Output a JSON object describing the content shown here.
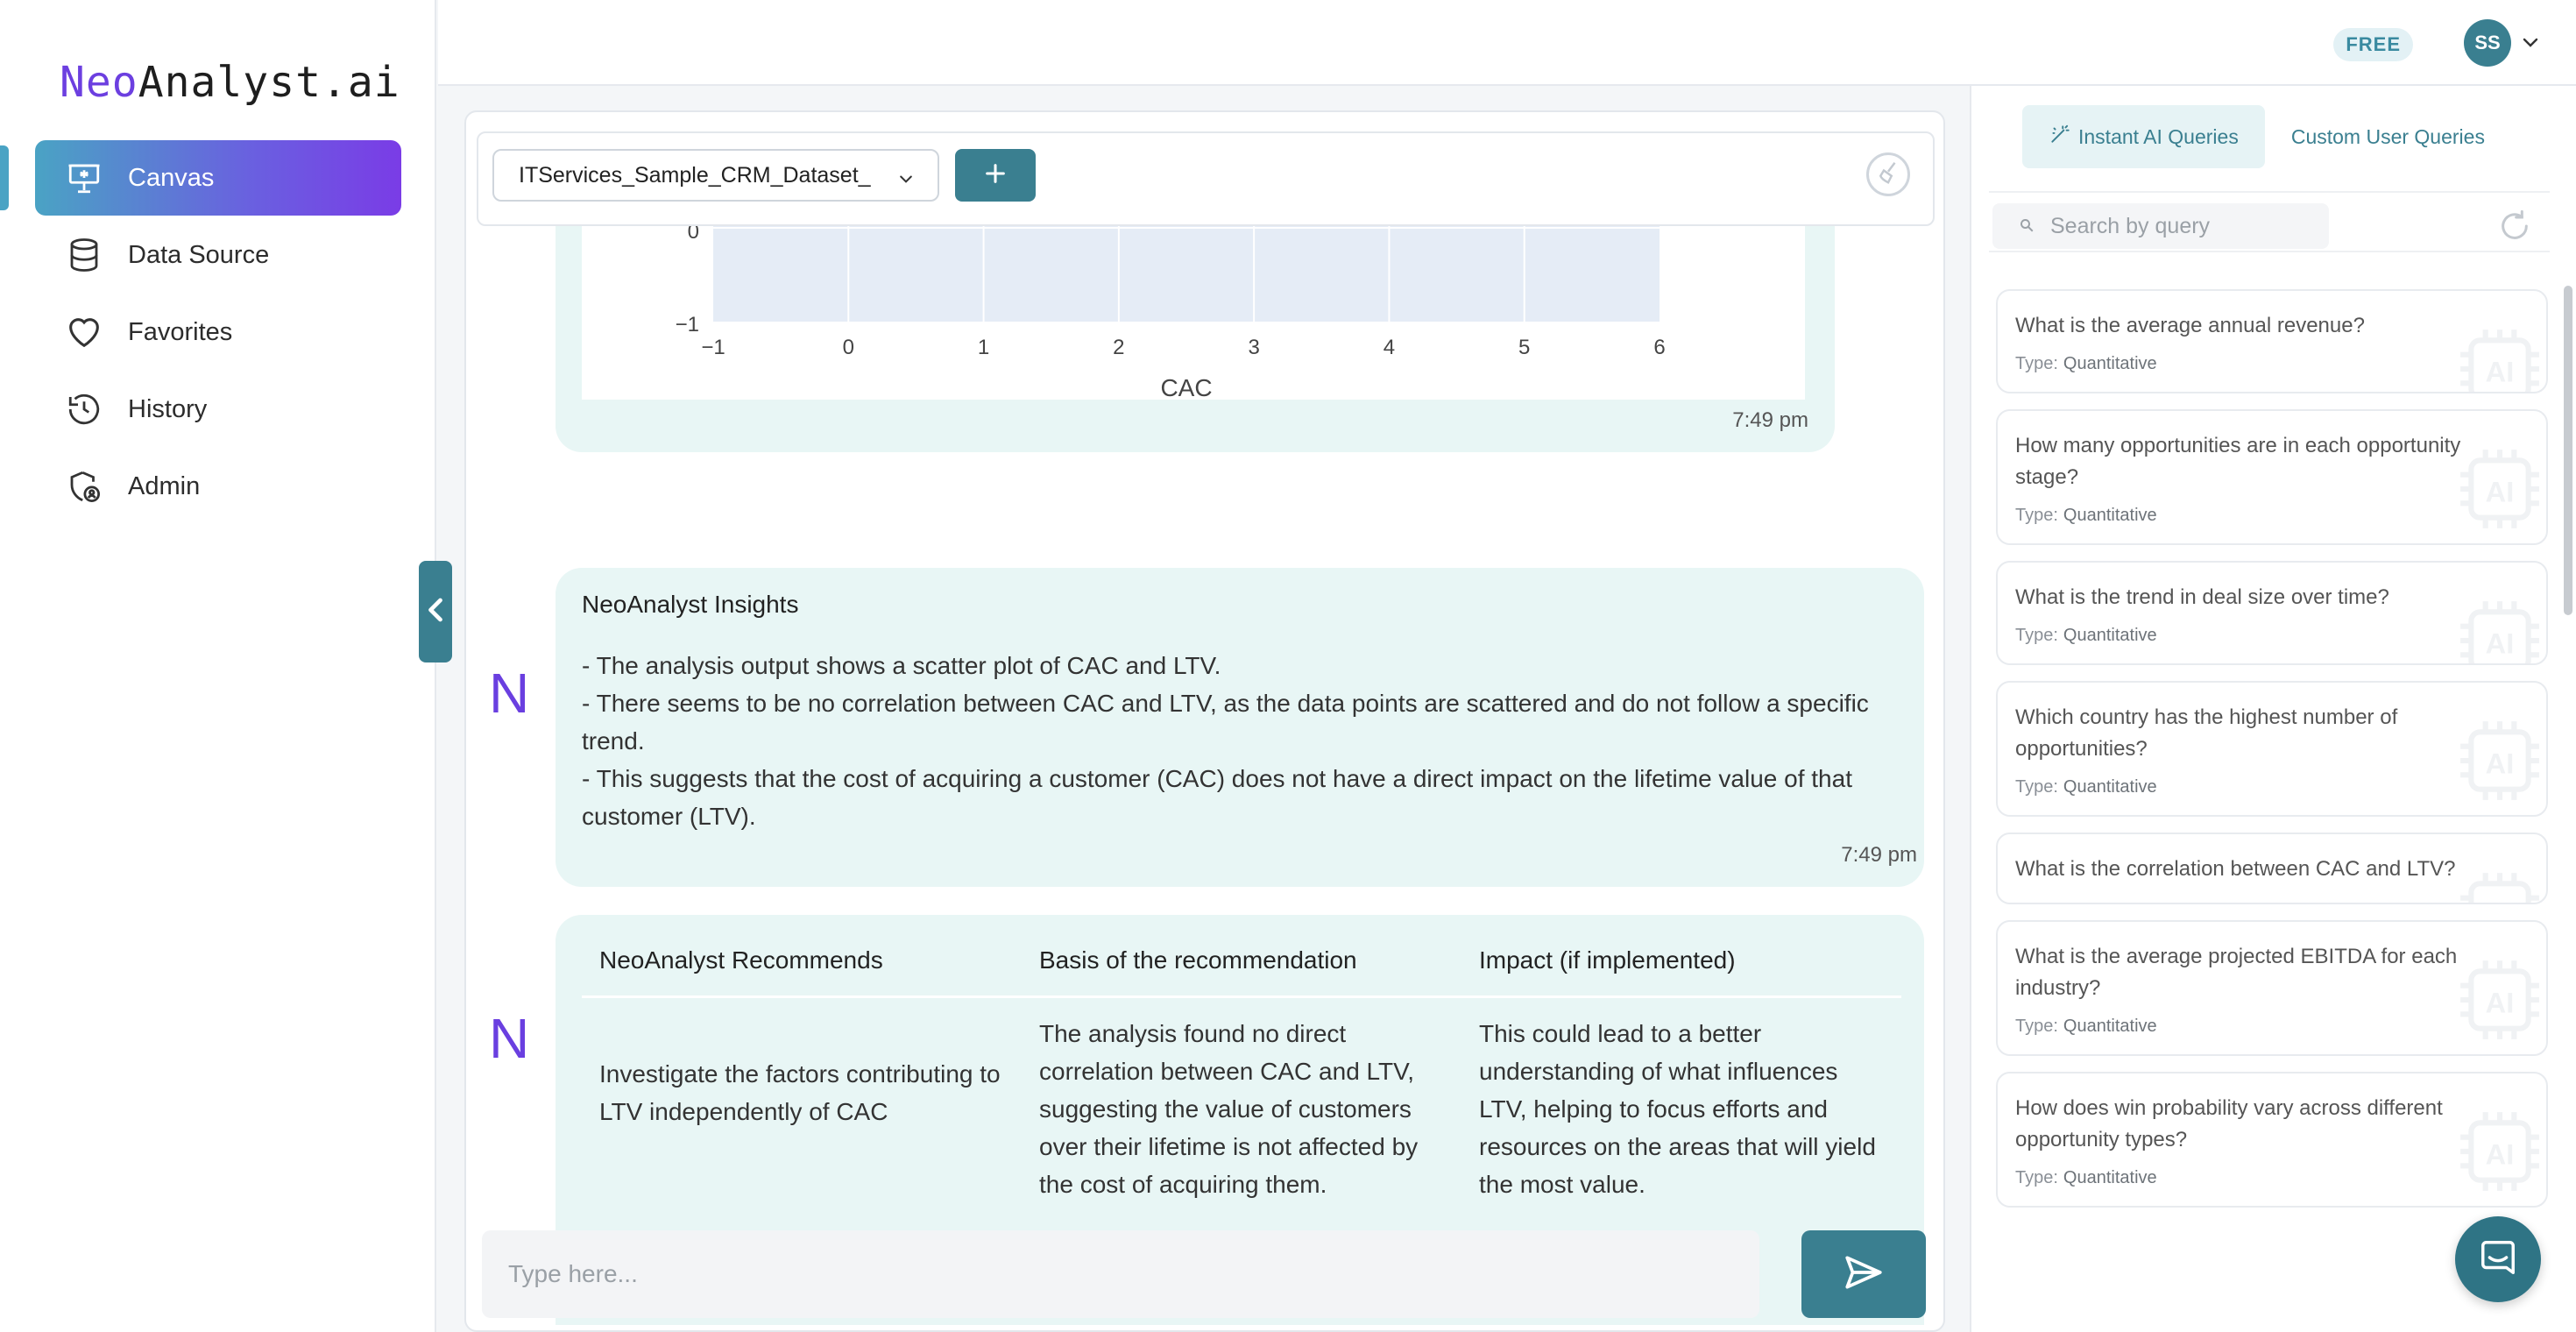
{
  "app": {
    "logo_part1": "Neo",
    "logo_part2": "Analyst.ai"
  },
  "sidebar": {
    "items": [
      {
        "label": "Canvas",
        "icon": "canvas-icon",
        "active": true
      },
      {
        "label": "Data Source",
        "icon": "database-icon",
        "active": false
      },
      {
        "label": "Favorites",
        "icon": "heart-icon",
        "active": false
      },
      {
        "label": "History",
        "icon": "history-icon",
        "active": false
      },
      {
        "label": "Admin",
        "icon": "admin-icon",
        "active": false
      }
    ]
  },
  "topbar": {
    "plan": "FREE",
    "avatar_initials": "SS"
  },
  "toolbar": {
    "dataset": "ITServices_Sample_CRM_Dataset_"
  },
  "chart": {
    "y_tick_labels": [
      "0",
      "−1"
    ],
    "x_tick_labels": [
      "−1",
      "0",
      "1",
      "2",
      "3",
      "4",
      "5",
      "6"
    ],
    "xlabel": "CAC"
  },
  "messages": {
    "chart_time": "7:49 pm",
    "avatar_letter": "N",
    "insights": {
      "title": "NeoAnalyst Insights",
      "lines": [
        "- The analysis output shows a scatter plot of CAC and LTV.",
        "- There seems to be no correlation between CAC and LTV, as the data points are scattered and do not follow a specific trend.",
        "- This suggests that the cost of acquiring a customer (CAC) does not have a direct impact on the lifetime value of that customer (LTV)."
      ],
      "time": "7:49 pm"
    },
    "recommendations": {
      "headers": [
        "NeoAnalyst Recommends",
        "Basis of the recommendation",
        "Impact (if implemented)"
      ],
      "row": [
        "Investigate the factors contributing to LTV independently of CAC",
        "The analysis found no direct correlation between CAC and LTV, suggesting the value of customers over their lifetime is not affected by the cost of acquiring them.",
        "This could lead to a better understanding of what influences LTV, helping to focus efforts and resources on the areas that will yield the most value."
      ]
    }
  },
  "input": {
    "placeholder": "Type here..."
  },
  "right_panel": {
    "tabs": [
      {
        "label": "Instant AI Queries",
        "active": true
      },
      {
        "label": "Custom User Queries",
        "active": false
      }
    ],
    "search_placeholder": "Search by query",
    "type_label": "Type:",
    "queries": [
      {
        "question": "What is the average annual revenue?",
        "type": "Quantitative"
      },
      {
        "question": "How many opportunities are in each opportunity stage?",
        "type": "Quantitative"
      },
      {
        "question": "What is the trend in deal size over time?",
        "type": "Quantitative"
      },
      {
        "question": "Which country has the highest number of opportunities?",
        "type": "Quantitative"
      },
      {
        "question": "What is the correlation between CAC and LTV?",
        "type": ""
      },
      {
        "question": "What is the average projected EBITDA for each industry?",
        "type": "Quantitative"
      },
      {
        "question": "How does win probability vary across different opportunity types?",
        "type": "Quantitative"
      }
    ]
  },
  "colors": {
    "brand_teal": "#3a7f90",
    "brand_purple": "#6a3fe0",
    "bubble_bg": "#e8f6f5"
  }
}
